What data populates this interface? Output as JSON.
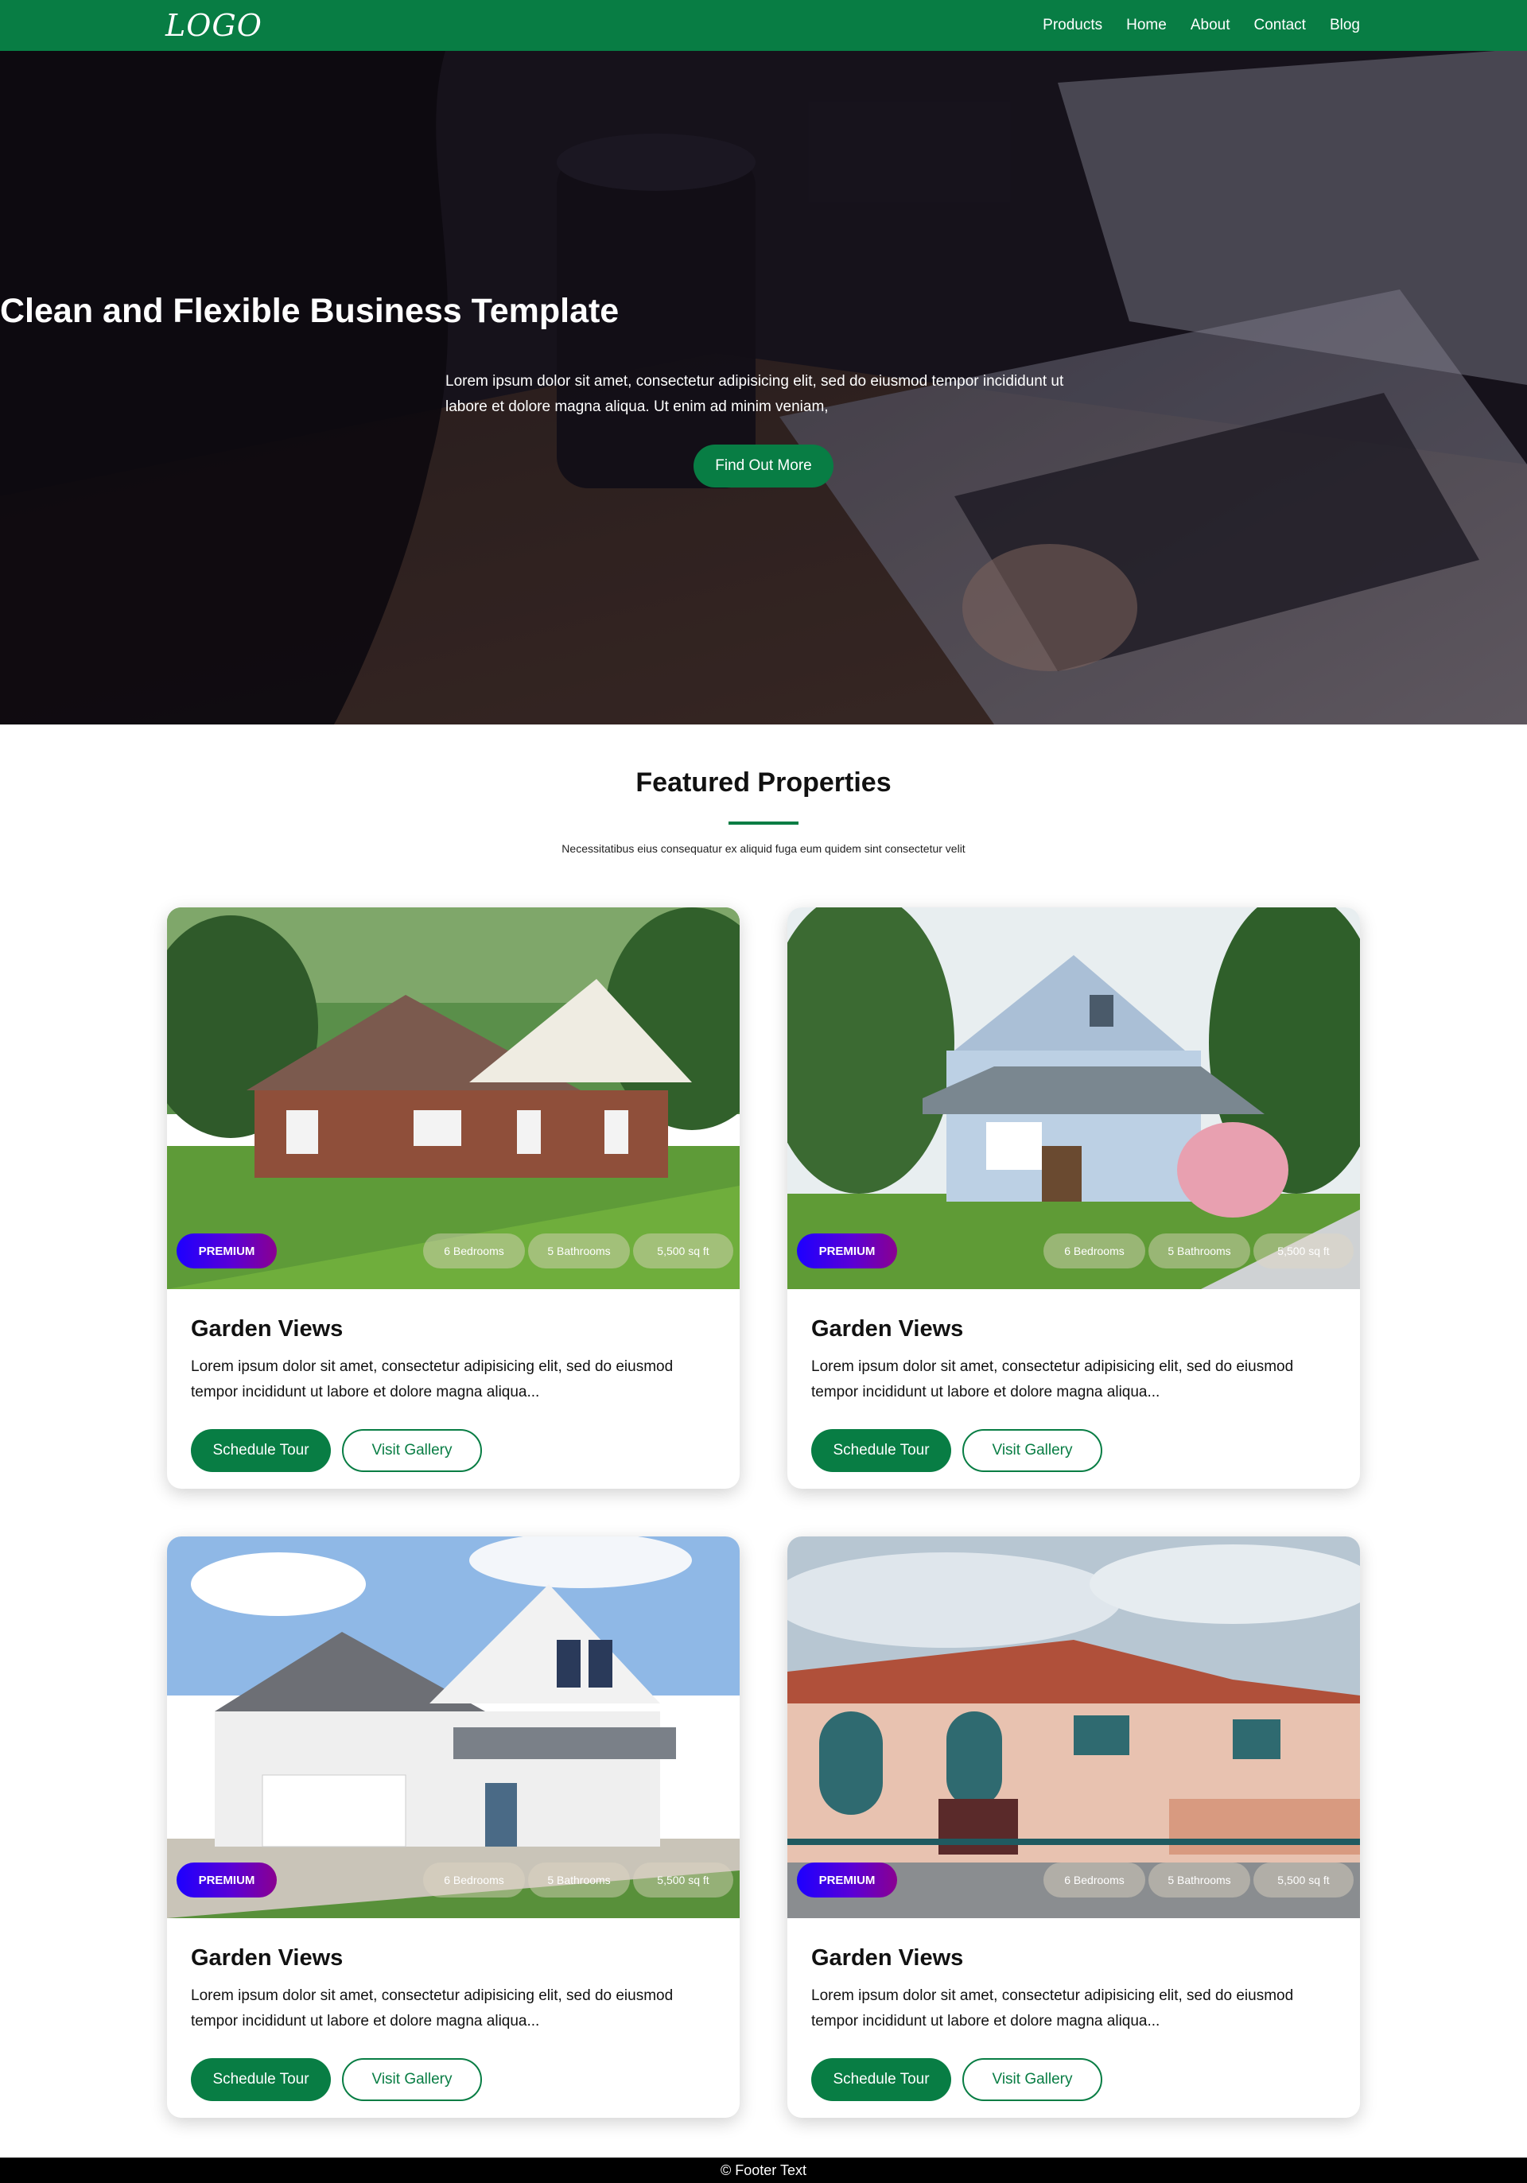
{
  "nav": {
    "logo": "LOGO",
    "links": [
      "Products",
      "Home",
      "About",
      "Contact",
      "Blog"
    ]
  },
  "hero": {
    "title": "Clean and Flexible Business Template",
    "text": "Lorem ipsum dolor sit amet, consectetur adipisicing elit, sed do eiusmod tempor incididunt ut labore et dolore magna aliqua. Ut enim ad minim veniam,",
    "button": "Find Out More"
  },
  "section": {
    "title": "Featured Properties",
    "subtitle": "Necessitatibus eius consequatur ex aliquid fuga eum quidem sint consectetur velit"
  },
  "cards": [
    {
      "badge": "PREMIUM",
      "bedrooms": "6 Bedrooms",
      "bathrooms": "5 Bathrooms",
      "area": "5,500 sq ft",
      "title": "Garden Views",
      "text": "Lorem ipsum dolor sit amet, consectetur adipisicing elit, sed do eiusmod tempor incididunt ut labore et dolore magna aliqua...",
      "tour_button": "Schedule Tour",
      "gallery_button": "Visit Gallery"
    },
    {
      "badge": "PREMIUM",
      "bedrooms": "6 Bedrooms",
      "bathrooms": "5 Bathrooms",
      "area": "5,500 sq ft",
      "title": "Garden Views",
      "text": "Lorem ipsum dolor sit amet, consectetur adipisicing elit, sed do eiusmod tempor incididunt ut labore et dolore magna aliqua...",
      "tour_button": "Schedule Tour",
      "gallery_button": "Visit Gallery"
    },
    {
      "badge": "PREMIUM",
      "bedrooms": "6 Bedrooms",
      "bathrooms": "5 Bathrooms",
      "area": "5,500 sq ft",
      "title": "Garden Views",
      "text": "Lorem ipsum dolor sit amet, consectetur adipisicing elit, sed do eiusmod tempor incididunt ut labore et dolore magna aliqua...",
      "tour_button": "Schedule Tour",
      "gallery_button": "Visit Gallery"
    },
    {
      "badge": "PREMIUM",
      "bedrooms": "6 Bedrooms",
      "bathrooms": "5 Bathrooms",
      "area": "5,500 sq ft",
      "title": "Garden Views",
      "text": "Lorem ipsum dolor sit amet, consectetur adipisicing elit, sed do eiusmod tempor incididunt ut labore et dolore magna aliqua...",
      "tour_button": "Schedule Tour",
      "gallery_button": "Visit Gallery"
    }
  ],
  "footer": {
    "text": "© Footer Text"
  },
  "colors": {
    "brand": "#087d44",
    "footer": "#000000",
    "badge_start": "#1d00ff",
    "badge_end": "#8a0090"
  }
}
